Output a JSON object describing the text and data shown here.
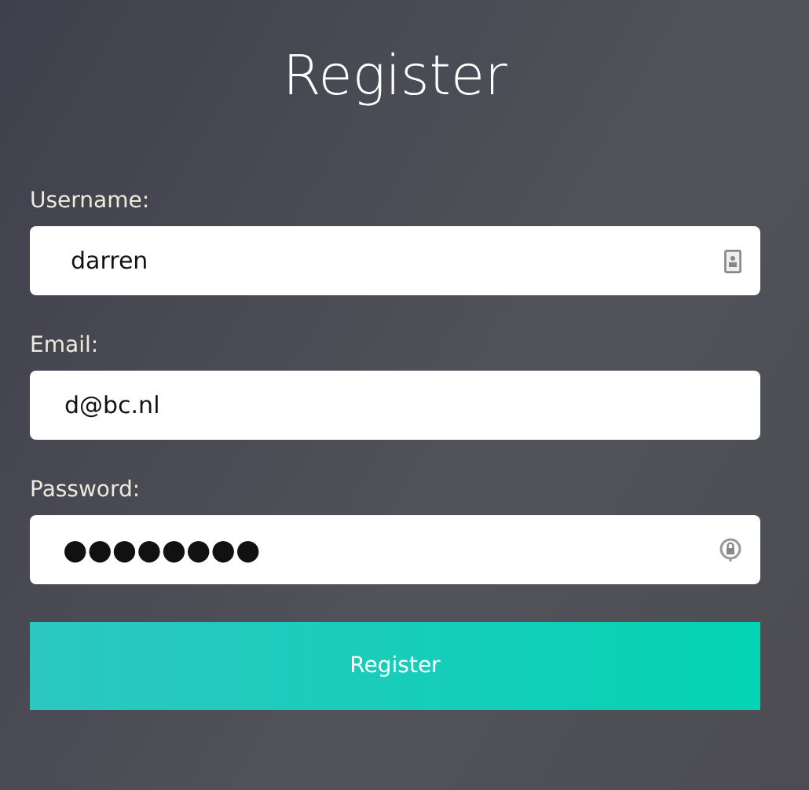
{
  "title": "Register",
  "fields": [
    {
      "label": "Username:",
      "value": "darren",
      "kind": "username"
    },
    {
      "label": "Email:",
      "value": "d@bc.nl",
      "kind": "email"
    },
    {
      "label": "Password:",
      "value": "●●●●●●●●",
      "kind": "password"
    }
  ],
  "button": "Register"
}
